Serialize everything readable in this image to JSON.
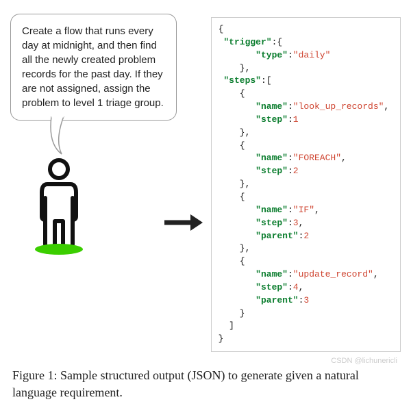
{
  "speech": "Create a flow that runs every day at midnight, and then find all the newly created problem records for the past day. If they are not assigned, assign the problem to level 1 triage group.",
  "code": {
    "trigger_key": "\"trigger\"",
    "type_key": "\"type\"",
    "type_val": "\"daily\"",
    "steps_key": "\"steps\"",
    "name_key": "\"name\"",
    "step_key": "\"step\"",
    "parent_key": "\"parent\"",
    "s1_name": "\"look_up_records\"",
    "s1_step": "1",
    "s2_name": "\"FOREACH\"",
    "s2_step": "2",
    "s3_name": "\"IF\"",
    "s3_step": "3",
    "s3_parent": "2",
    "s4_name": "\"update_record\"",
    "s4_step": "4",
    "s4_parent": "3"
  },
  "caption": "Figure 1: Sample structured output (JSON) to generate given a natural language requirement.",
  "watermark": "CSDN @lichunericli"
}
